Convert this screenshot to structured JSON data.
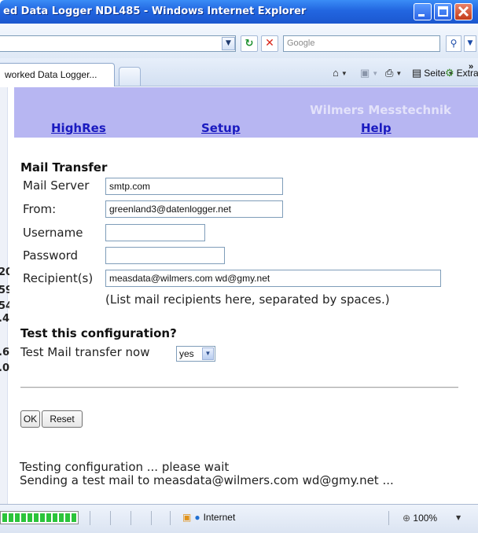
{
  "window": {
    "title": "ed Data Logger NDL485 - Windows Internet Explorer"
  },
  "toolbar": {
    "search_placeholder": "Google",
    "refresh_icon": "refresh-icon",
    "stop_icon": "stop-icon",
    "search_icon": "magnifier-icon"
  },
  "tabs": {
    "active_label": "worked Data Logger...",
    "page_menu": "Seite",
    "tools_menu": "Extras",
    "more": "»"
  },
  "page": {
    "brand": "Wilmers Messtechnik",
    "nav": {
      "highres": "HighRes",
      "setup": "Setup",
      "help": "Help"
    },
    "left_fragments": [
      "20",
      "59",
      "54",
      ".4",
      ".6",
      ".0"
    ],
    "mail": {
      "heading": "Mail Transfer",
      "server_label": "Mail Server",
      "server_value": "smtp.com",
      "from_label": "From:",
      "from_value": "greenland3@datenlogger.net",
      "username_label": "Username",
      "username_value": "",
      "password_label": "Password",
      "password_value": "",
      "recipients_label": "Recipient(s)",
      "recipients_value": "measdata@wilmers.com wd@gmy.net",
      "recipients_hint": "(List mail recipients here, separated by spaces.)"
    },
    "test": {
      "heading": "Test this configuration?",
      "label": "Test Mail transfer now",
      "selected": "yes"
    },
    "buttons": {
      "ok": "OK",
      "reset": "Reset"
    },
    "status": {
      "line1": "Testing configuration ... please wait",
      "line2": "Sending a test mail to measdata@wilmers.com wd@gmy.net ..."
    }
  },
  "statusbar": {
    "progress": 1.0,
    "zone": "Internet",
    "zoom": "100%"
  },
  "colors": {
    "title_bar": "#2266e0",
    "header_band": "#b7b6f2",
    "nav_link": "#1a1ac0",
    "progress": "#2bc43a"
  }
}
